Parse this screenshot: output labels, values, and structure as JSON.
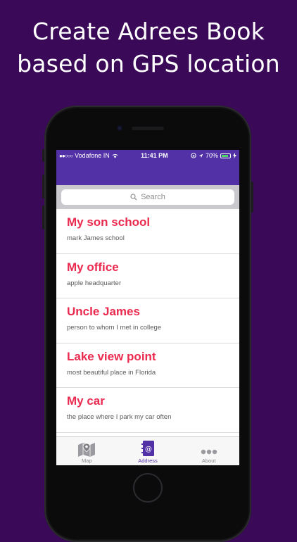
{
  "headline": {
    "line1": "Create Adrees Book",
    "line2": "based on GPS location"
  },
  "status_bar": {
    "carrier": "Vodafone IN",
    "time": "11:41 PM",
    "battery": "70%",
    "icons": [
      "signal-dots-icon",
      "wifi-icon",
      "lock-rotation-icon",
      "location-arrow-icon",
      "battery-icon",
      "charging-icon"
    ]
  },
  "search": {
    "placeholder": "Search",
    "icon": "search-icon"
  },
  "entries": [
    {
      "title": "My son school",
      "subtitle": "mark James school"
    },
    {
      "title": "My office",
      "subtitle": "apple headquarter"
    },
    {
      "title": "Uncle James",
      "subtitle": "person to whom I met in college"
    },
    {
      "title": "Lake view point",
      "subtitle": "most beautiful place in Florida"
    },
    {
      "title": "My car",
      "subtitle": "the place where I park my car often"
    }
  ],
  "tabs": [
    {
      "label": "Map",
      "icon": "map-pin-icon",
      "active": false
    },
    {
      "label": "Address",
      "icon": "address-book-icon",
      "active": true
    },
    {
      "label": "About",
      "icon": "more-dots-icon",
      "active": false
    }
  ],
  "colors": {
    "background": "#3a0a58",
    "nav": "#5231a6",
    "title": "#ea2b4f",
    "accent": "#5231a6"
  }
}
